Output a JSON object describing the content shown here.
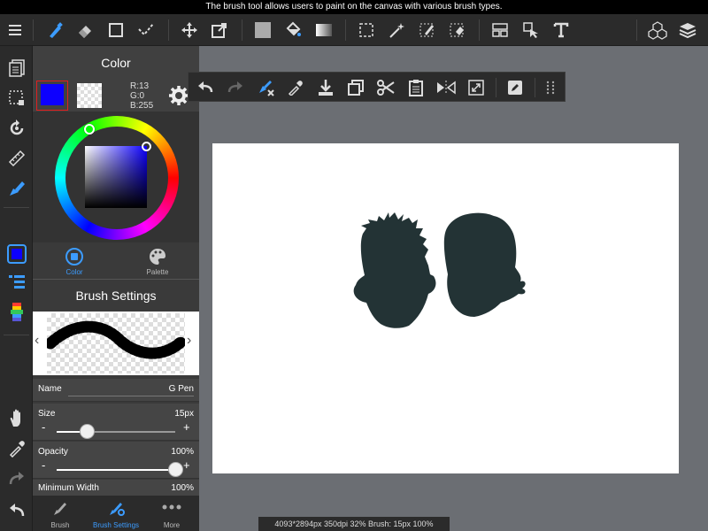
{
  "tooltip": "The brush tool allows users to paint on the canvas with various brush types.",
  "toolbar": {
    "items": [
      "menu-icon",
      "brush-icon",
      "eraser-icon",
      "rect-shape-icon",
      "dotted-pen-icon",
      "move-icon",
      "transform-icon",
      "fill-color-icon",
      "bucket-icon",
      "gradient-icon",
      "select-rect-icon",
      "magic-wand-icon",
      "select-pen-icon",
      "select-eraser-icon",
      "layout-icon",
      "operation-icon",
      "text-icon",
      "3d-material-icon",
      "layers-icon"
    ]
  },
  "left_rail": [
    "pages-icon",
    "selection-icon",
    "rotate-icon",
    "ruler-icon",
    "filter-brush-icon",
    "color-swatch-icon",
    "layer-list-icon",
    "palette-strip-icon",
    "hand-icon",
    "eyedropper-icon",
    "redo-icon",
    "undo-icon"
  ],
  "color_panel": {
    "title": "Color",
    "rgb": {
      "r": "R:13",
      "g": "G:0",
      "b": "B:255"
    },
    "primary_color": "#0d00ff",
    "tabs": [
      {
        "label": "Color"
      },
      {
        "label": "Palette"
      }
    ]
  },
  "brush_settings": {
    "title": "Brush Settings",
    "name_label": "Name",
    "name_value": "G Pen",
    "size_label": "Size",
    "size_value": "15px",
    "size_level": 0.25,
    "opacity_label": "Opacity",
    "opacity_value": "100%",
    "opacity_level": 1.0,
    "minwidth_label": "Minimum Width",
    "minwidth_value": "100%",
    "minus": "-",
    "plus": "+"
  },
  "bottom_tabs": [
    {
      "label": "Brush"
    },
    {
      "label": "Brush Settings"
    },
    {
      "label": "More"
    }
  ],
  "floating_bar": [
    "undo-icon",
    "redo-icon",
    "brush-clear-icon",
    "eyedropper-icon",
    "download-icon",
    "copy-icon",
    "cut-icon",
    "paste-icon",
    "flip-icon",
    "fit-icon",
    "edit-icon",
    "grip-icon"
  ],
  "status": "4093*2894px 350dpi 32% Brush: 15px 100%",
  "colors": {
    "accent": "#3c9cff",
    "silhouette": "#233335"
  }
}
